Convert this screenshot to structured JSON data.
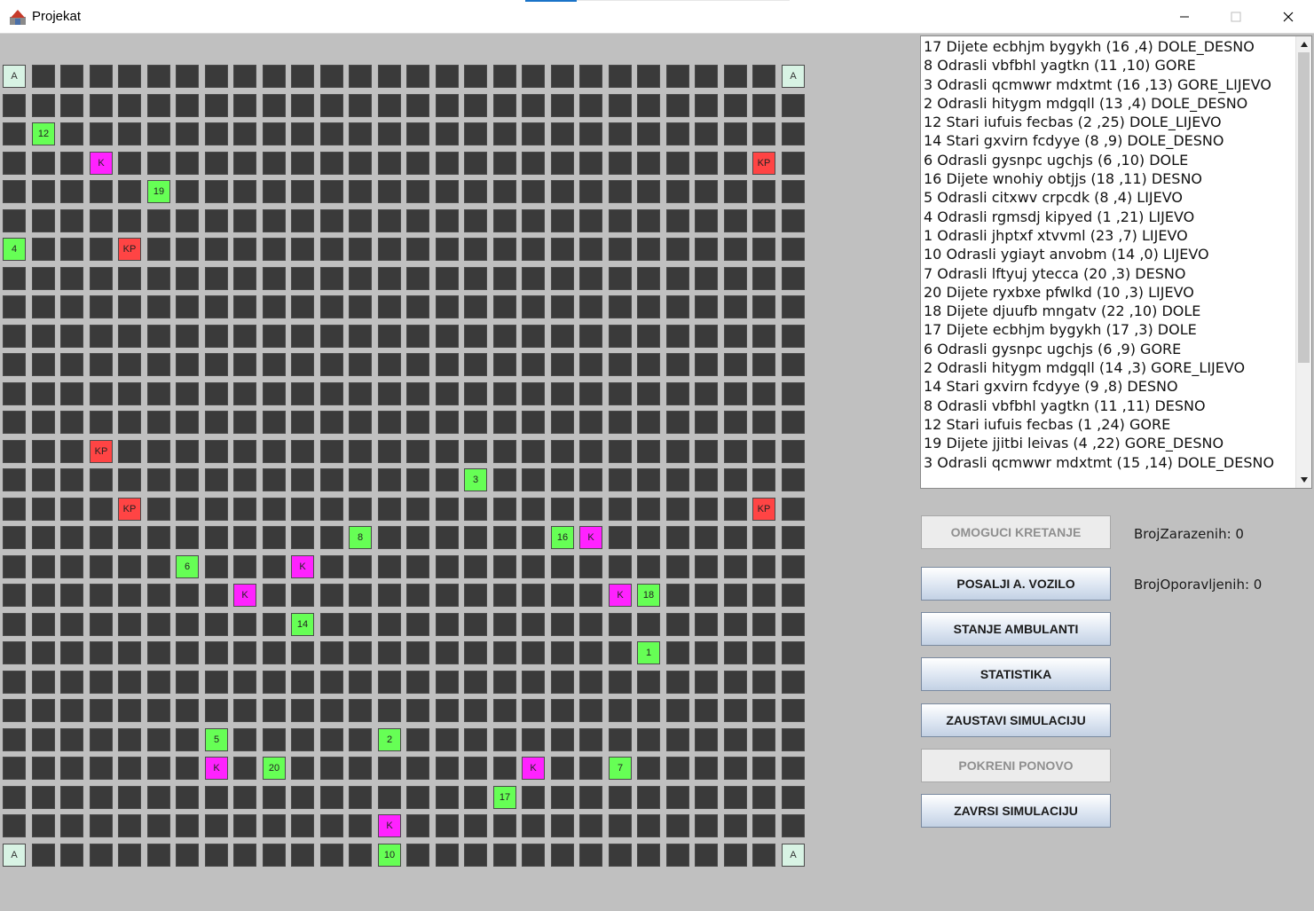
{
  "window": {
    "title": "Projekat",
    "icons": {
      "app": "app-icon",
      "minimize": "minimize-icon",
      "maximize": "maximize-icon",
      "close": "close-icon"
    }
  },
  "colors": {
    "background": "#c0c0c0",
    "empty_cell": "#3a3a3a",
    "ambulance_cell": "#d8f3e4",
    "person_cell": "#66ff55",
    "k_cell": "#ff22ff",
    "kp_cell": "#ff4444"
  },
  "grid": {
    "rows": 28,
    "cols": 28,
    "markers": [
      {
        "row": 0,
        "col": 0,
        "label": "A",
        "type": "amb"
      },
      {
        "row": 0,
        "col": 27,
        "label": "A",
        "type": "amb"
      },
      {
        "row": 2,
        "col": 1,
        "label": "12",
        "type": "person"
      },
      {
        "row": 3,
        "col": 3,
        "label": "K",
        "type": "k"
      },
      {
        "row": 3,
        "col": 26,
        "label": "KP",
        "type": "kp"
      },
      {
        "row": 4,
        "col": 5,
        "label": "19",
        "type": "person"
      },
      {
        "row": 6,
        "col": 0,
        "label": "4",
        "type": "person"
      },
      {
        "row": 6,
        "col": 4,
        "label": "KP",
        "type": "kp"
      },
      {
        "row": 13,
        "col": 3,
        "label": "KP",
        "type": "kp"
      },
      {
        "row": 14,
        "col": 16,
        "label": "3",
        "type": "person"
      },
      {
        "row": 15,
        "col": 4,
        "label": "KP",
        "type": "kp"
      },
      {
        "row": 15,
        "col": 26,
        "label": "KP",
        "type": "kp"
      },
      {
        "row": 16,
        "col": 12,
        "label": "8",
        "type": "person"
      },
      {
        "row": 16,
        "col": 19,
        "label": "16",
        "type": "person"
      },
      {
        "row": 16,
        "col": 20,
        "label": "K",
        "type": "k"
      },
      {
        "row": 17,
        "col": 6,
        "label": "6",
        "type": "person"
      },
      {
        "row": 17,
        "col": 10,
        "label": "K",
        "type": "k"
      },
      {
        "row": 18,
        "col": 8,
        "label": "K",
        "type": "k"
      },
      {
        "row": 18,
        "col": 21,
        "label": "K",
        "type": "k"
      },
      {
        "row": 18,
        "col": 22,
        "label": "18",
        "type": "person"
      },
      {
        "row": 19,
        "col": 10,
        "label": "14",
        "type": "person"
      },
      {
        "row": 20,
        "col": 22,
        "label": "1",
        "type": "person"
      },
      {
        "row": 23,
        "col": 7,
        "label": "5",
        "type": "person"
      },
      {
        "row": 23,
        "col": 13,
        "label": "2",
        "type": "person"
      },
      {
        "row": 24,
        "col": 7,
        "label": "K",
        "type": "k"
      },
      {
        "row": 24,
        "col": 9,
        "label": "20",
        "type": "person"
      },
      {
        "row": 24,
        "col": 18,
        "label": "K",
        "type": "k"
      },
      {
        "row": 24,
        "col": 21,
        "label": "7",
        "type": "person"
      },
      {
        "row": 25,
        "col": 17,
        "label": "17",
        "type": "person"
      },
      {
        "row": 26,
        "col": 13,
        "label": "K",
        "type": "k"
      },
      {
        "row": 27,
        "col": 0,
        "label": "A",
        "type": "amb"
      },
      {
        "row": 27,
        "col": 13,
        "label": "10",
        "type": "person"
      },
      {
        "row": 27,
        "col": 27,
        "label": "A",
        "type": "amb"
      }
    ]
  },
  "log": [
    "17 Dijete ecbhjm bygykh (16 ,4) DOLE_DESNO",
    "8 Odrasli vbfbhl yagtkn (11 ,10) GORE",
    "3 Odrasli qcmwwr mdxtmt (16 ,13) GORE_LIJEVO",
    "2 Odrasli hitygm mdgqll (13 ,4) DOLE_DESNO",
    "12 Stari iufuis fecbas (2 ,25) DOLE_LIJEVO",
    "14 Stari gxvirn fcdyye (8 ,9) DOLE_DESNO",
    "6 Odrasli gysnpc ugchjs (6 ,10) DOLE",
    "16 Dijete wnohiy obtjjs (18 ,11) DESNO",
    "5 Odrasli citxwv crpcdk (8 ,4) LIJEVO",
    "4 Odrasli rgmsdj kipyed (1 ,21) LIJEVO",
    "1 Odrasli jhptxf xtvvml (23 ,7) LIJEVO",
    "10 Odrasli ygiayt anvobm (14 ,0) LIJEVO",
    "7 Odrasli lftyuj ytecca (20 ,3) DESNO",
    "20 Dijete ryxbxe pfwlkd (10 ,3) LIJEVO",
    "18 Dijete djuufb mngatv (22 ,10) DOLE",
    "17 Dijete ecbhjm bygykh (17 ,3) DOLE",
    "6 Odrasli gysnpc ugchjs (6 ,9) GORE",
    "2 Odrasli hitygm mdgqll (14 ,3) GORE_LIJEVO",
    "14 Stari gxvirn fcdyye (9 ,8) DESNO",
    "8 Odrasli vbfbhl yagtkn (11 ,11) DESNO",
    "12 Stari iufuis fecbas (1 ,24) GORE",
    "19 Dijete jjitbi leivas (4 ,22) GORE_DESNO",
    "3 Odrasli qcmwwr mdxtmt (15 ,14) DOLE_DESNO"
  ],
  "scrollbar": {
    "up_icon": "scroll-up-arrow-icon",
    "down_icon": "scroll-down-arrow-icon"
  },
  "buttons": {
    "omoguci": "OMOGUCI KRETANJE",
    "posalji": "POSALJI A. VOZILO",
    "stanje": "STANJE AMBULANTI",
    "statistika": "STATISTIKA",
    "zaustavi": "ZAUSTAVI SIMULACIJU",
    "pokreni": "POKRENI PONOVO",
    "zavrsi": "ZAVRSI SIMULACIJU"
  },
  "stats": {
    "zarazeni": "BrojZarazenih: 0",
    "oporavljeni": "BrojOporavljenih: 0"
  }
}
